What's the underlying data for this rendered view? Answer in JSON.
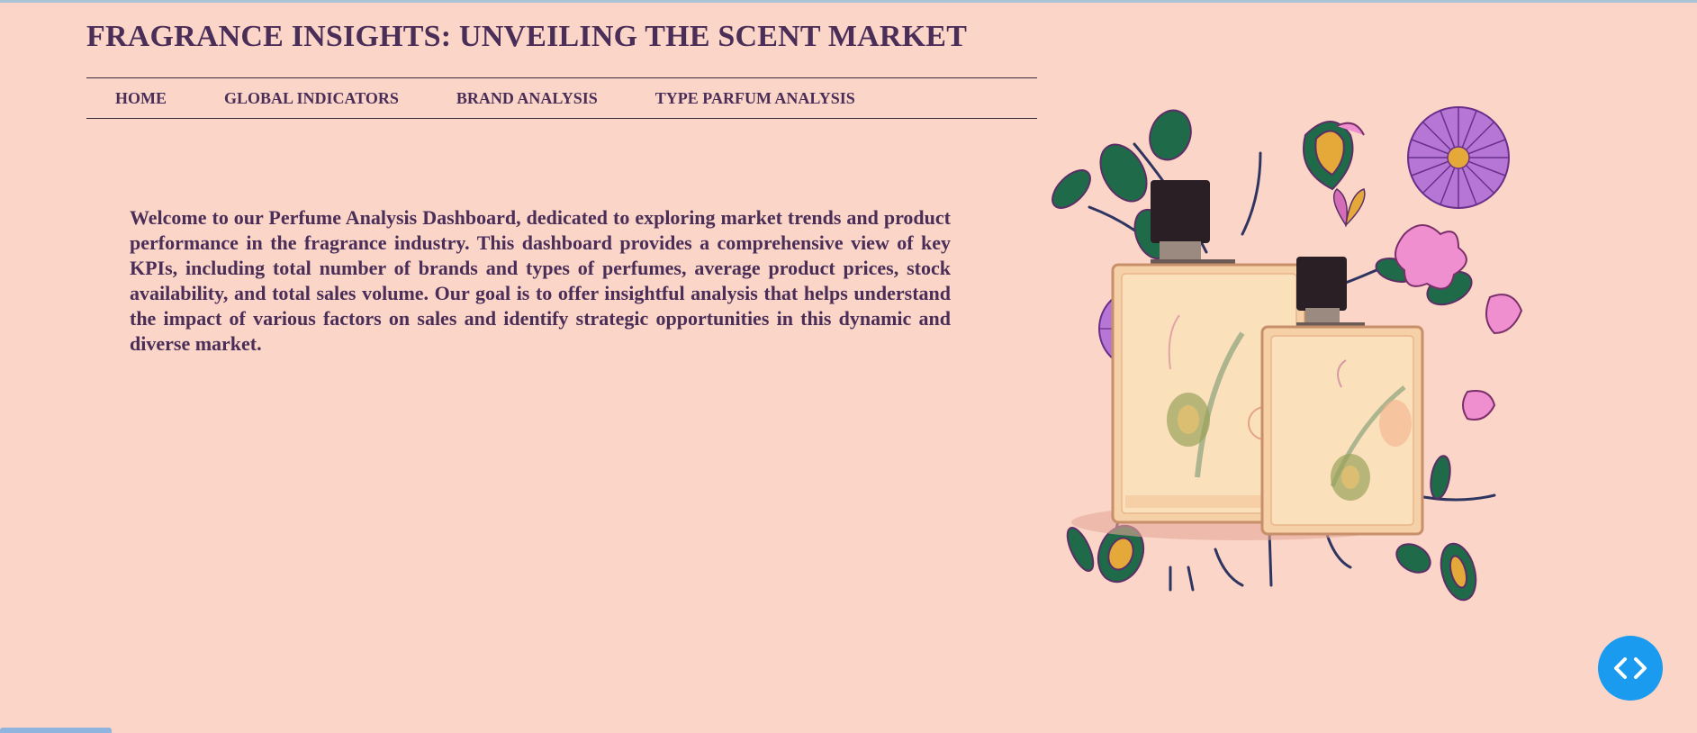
{
  "header": {
    "title": "FRAGRANCE INSIGHTS: UNVEILING THE SCENT MARKET"
  },
  "nav": {
    "items": [
      {
        "label": "HOME"
      },
      {
        "label": "GLOBAL INDICATORS"
      },
      {
        "label": "BRAND ANALYSIS"
      },
      {
        "label": "TYPE PARFUM ANALYSIS"
      }
    ]
  },
  "main": {
    "intro": "Welcome to our Perfume Analysis Dashboard, dedicated to exploring market trends and product performance in the fragrance industry. This dashboard provides a comprehensive view of key KPIs, including total number of brands and types of perfumes, average product prices, stock availability, and total sales volume. Our goal is to offer insightful analysis that helps understand the impact of various factors on sales and identify strategic opportunities in this dynamic and diverse market."
  },
  "widgets": {
    "code_toggle_icon": "code-brackets-icon",
    "illustration_icon": "perfume-bottles-illustration"
  },
  "colors": {
    "background": "#fbd5c8",
    "text": "#4a2e58",
    "accent_button": "#1a9bf0"
  }
}
